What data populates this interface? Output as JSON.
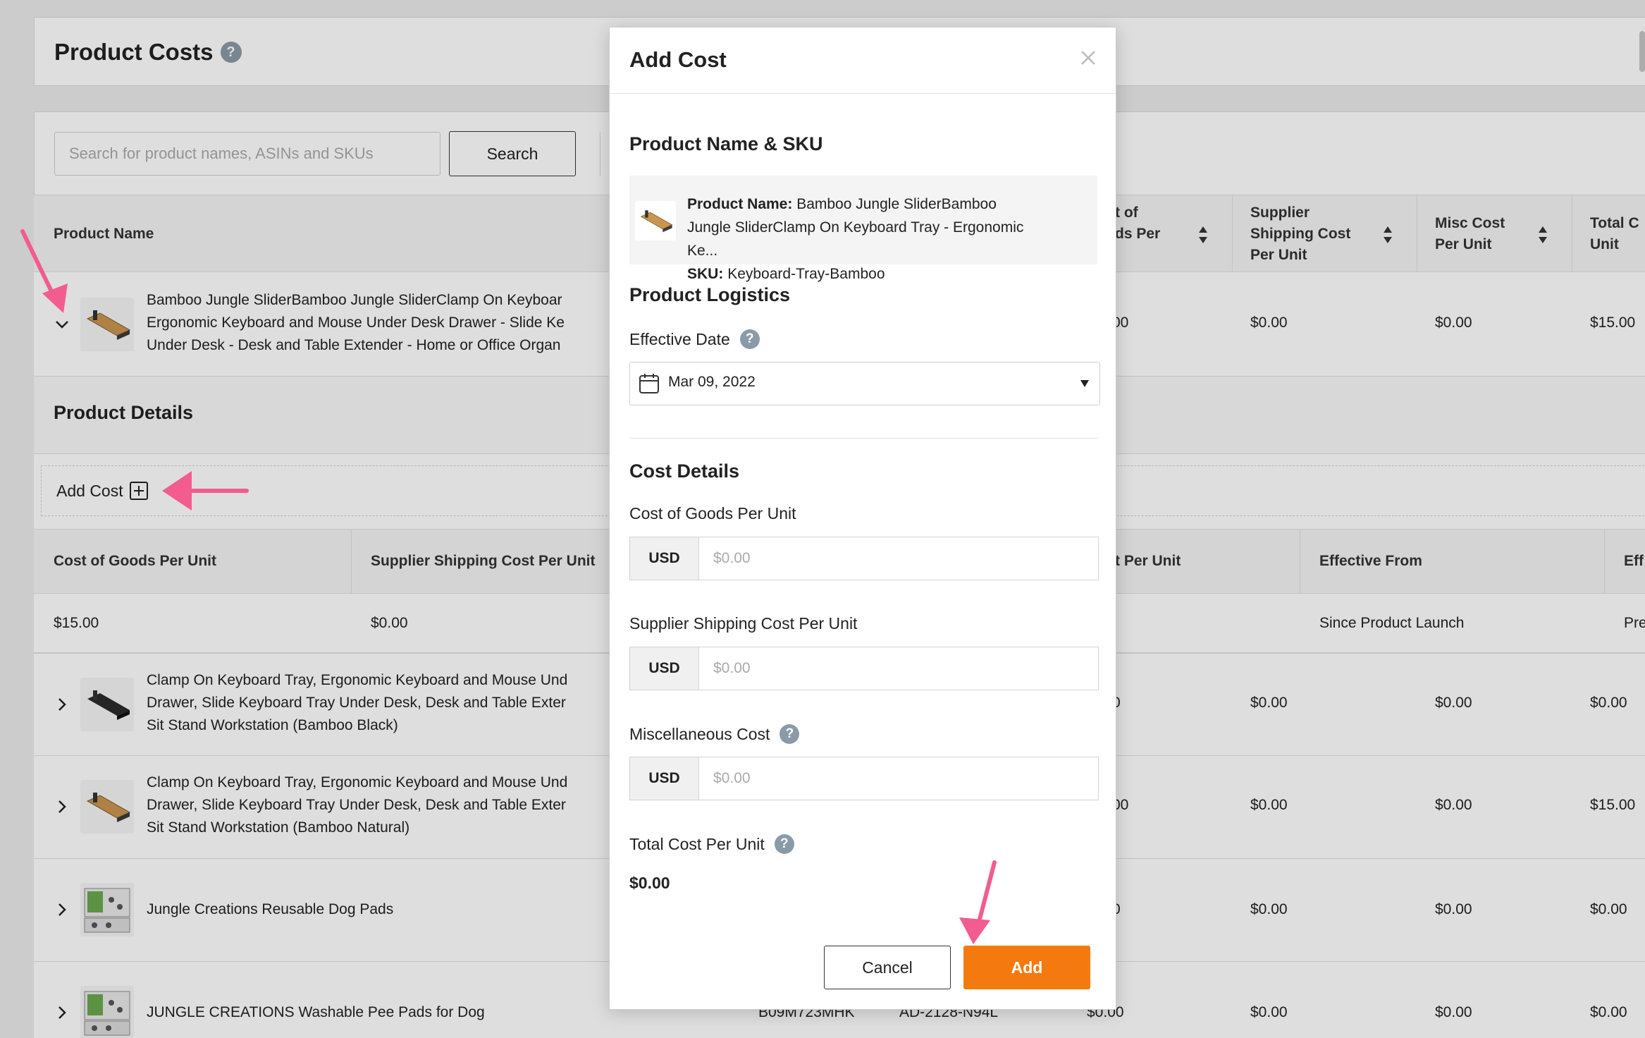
{
  "page": {
    "title": "Product Costs",
    "help": "?"
  },
  "search": {
    "placeholder": "Search for product names, ASINs and SKUs",
    "button": "Search"
  },
  "table": {
    "headers": {
      "product_name": "Product Name",
      "cost_of_goods_line1": "t of",
      "cost_of_goods_line2": "ds Per",
      "supplier_shipping_line1": "Supplier",
      "supplier_shipping_line2": "Shipping Cost",
      "supplier_shipping_line3": "Per Unit",
      "misc_line1": "Misc Cost",
      "misc_line2": "Per Unit",
      "total_line1": "Total C",
      "total_line2": "Unit"
    },
    "rows": [
      {
        "line1": "Bamboo Jungle SliderBamboo Jungle SliderClamp On Keyboar",
        "line2": "Ergonomic Keyboard and Mouse Under Desk Drawer - Slide Ke",
        "line3": "Under Desk - Desk and Table Extender - Home or Office Organ",
        "cog": "00",
        "ship": "$0.00",
        "misc": "$0.00",
        "total": "$15.00"
      },
      {
        "line1": "Clamp On Keyboard Tray, Ergonomic Keyboard and Mouse Und",
        "line2": "Drawer, Slide Keyboard Tray Under Desk, Desk and Table Exter",
        "line3": "Sit Stand Workstation (Bamboo Black)",
        "cog": "0",
        "ship": "$0.00",
        "misc": "$0.00",
        "total": "$0.00"
      },
      {
        "line1": "Clamp On Keyboard Tray, Ergonomic Keyboard and Mouse Und",
        "line2": "Drawer, Slide Keyboard Tray Under Desk, Desk and Table Exter",
        "line3": "Sit Stand Workstation (Bamboo Natural)",
        "cog": "00",
        "ship": "$0.00",
        "misc": "$0.00",
        "total": "$15.00"
      },
      {
        "line1": "Jungle Creations Reusable Dog Pads",
        "cog": "0",
        "ship": "$0.00",
        "misc": "$0.00",
        "total": "$0.00"
      },
      {
        "line1": "JUNGLE CREATIONS Washable Pee Pads for Dog",
        "asin": "B09M723MHK",
        "sku": "AD-2128-N94L",
        "cog": "$0.00",
        "ship": "$0.00",
        "misc": "$0.00",
        "total": "$0.00"
      }
    ]
  },
  "details": {
    "title": "Product Details",
    "add_cost": "Add Cost",
    "headers": {
      "cog": "Cost of Goods Per Unit",
      "ship": "Supplier Shipping Cost Per Unit",
      "misc": "t Per Unit",
      "from": "Effective From",
      "until": "Eff"
    },
    "row": {
      "cog": "$15.00",
      "ship": "$0.00",
      "from": "Since Product Launch",
      "until": "Pre"
    }
  },
  "modal": {
    "title": "Add Cost",
    "section_product": "Product Name & SKU",
    "product_name_label": "Product Name:",
    "product_name_value_line1": "Bamboo Jungle SliderBamboo",
    "product_name_value_line2": "Jungle SliderClamp On Keyboard Tray - Ergonomic",
    "product_name_value_line3": "Ke...",
    "sku_label": "SKU:",
    "sku_value": "Keyboard-Tray-Bamboo",
    "section_logistics": "Product Logistics",
    "effective_date_label": "Effective Date",
    "effective_date_value": "Mar 09, 2022",
    "section_cost": "Cost Details",
    "cog_label": "Cost of Goods Per Unit",
    "ship_label": "Supplier Shipping Cost Per Unit",
    "misc_label": "Miscellaneous Cost",
    "total_label": "Total Cost Per Unit",
    "total_value": "$0.00",
    "currency": "USD",
    "amount_placeholder": "$0.00",
    "cancel": "Cancel",
    "add": "Add"
  },
  "colors": {
    "accent": "#f47a0f",
    "annotation_arrow": "#f25c8e",
    "help_icon": "#8a9aa8"
  }
}
